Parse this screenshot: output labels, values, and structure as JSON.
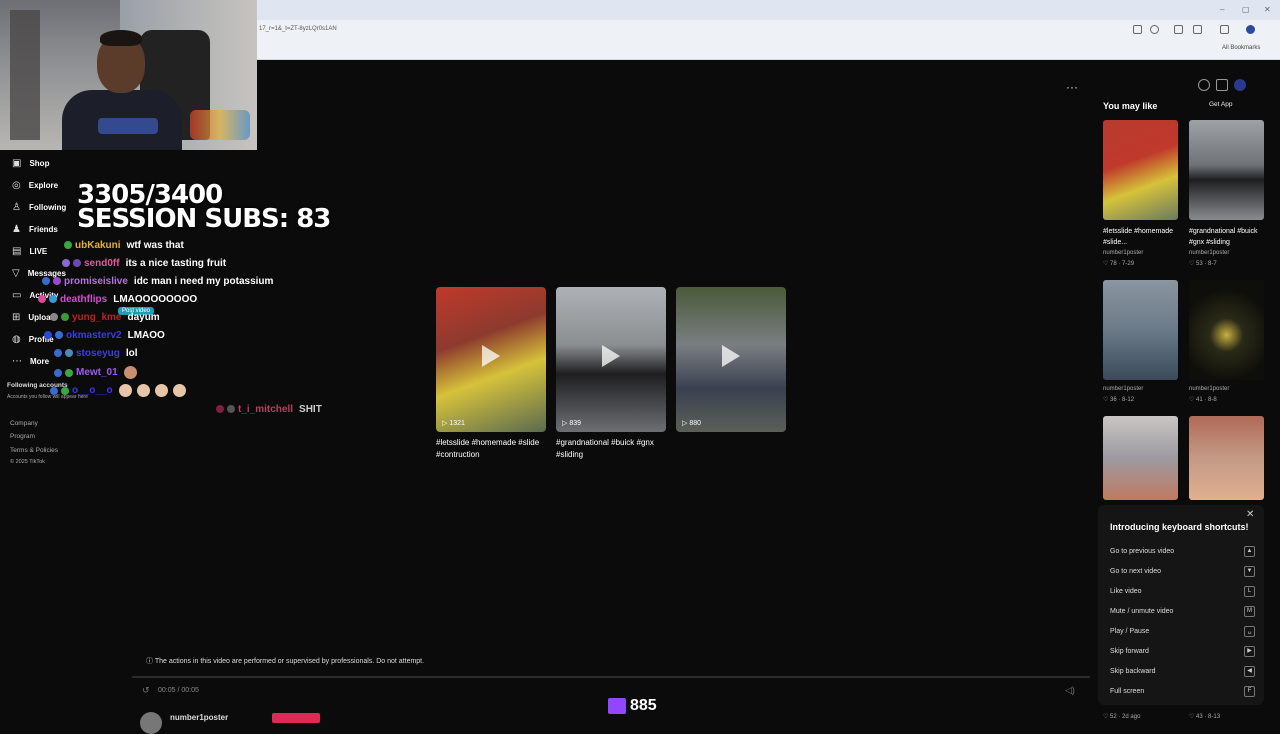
{
  "browser": {
    "url": "17_r=1&_t=ZT-8yzLQr0s1AN",
    "all_bookmarks": "All Bookmarks",
    "min": "–",
    "max": "▢",
    "close": "✕"
  },
  "stream": {
    "sub_counter_line1": "3305/3400",
    "sub_counter_line2": "SESSION SUBS: 83",
    "viewers": "885",
    "chat": [
      {
        "user": "ubKakuni",
        "text": "wtf was that",
        "color": "#e8b02a"
      },
      {
        "user": "send0ff",
        "text": "its a nice tasting fruit",
        "color": "#e05a9d"
      },
      {
        "user": "promiseislive",
        "text": "idc man i need my potassium",
        "color": "#b46ee8"
      },
      {
        "user": "deathflips",
        "text": "LMAOOOOOOOO",
        "color": "#e040e0"
      },
      {
        "user": "yung_kme",
        "text": "dayum",
        "color": "#c02020"
      },
      {
        "user": "okmasterv2",
        "text": "LMAOO",
        "color": "#3a3af0"
      },
      {
        "user": "stoseyug",
        "text": "lol",
        "color": "#3a3af0"
      },
      {
        "user": "Mewt_01",
        "text": "",
        "color": "#9a5af0"
      },
      {
        "user": "o__o__o",
        "text": "",
        "color": "#3a3af0"
      },
      {
        "user": "t_i_mitchell",
        "text": "SHIT",
        "color": "#c03a60"
      }
    ]
  },
  "sidebar": {
    "items": [
      {
        "label": "Shop",
        "icon": "shop-icon"
      },
      {
        "label": "Explore",
        "icon": "compass-icon"
      },
      {
        "label": "Following",
        "icon": "following-icon"
      },
      {
        "label": "Friends",
        "icon": "friends-icon"
      },
      {
        "label": "LIVE",
        "icon": "live-icon"
      },
      {
        "label": "Messages",
        "icon": "messages-icon"
      },
      {
        "label": "Activity",
        "icon": "activity-icon"
      },
      {
        "label": "Upload",
        "icon": "upload-icon"
      },
      {
        "label": "Profile",
        "icon": "profile-icon"
      },
      {
        "label": "More",
        "icon": "more-icon"
      }
    ],
    "post_video": "Post video",
    "following_accounts": "Following accounts",
    "following_hint": "Accounts you follow will appear here",
    "footer": [
      "Company",
      "Program",
      "Terms & Policies",
      "© 2025 TikTok"
    ]
  },
  "main": {
    "more": "···",
    "videos": [
      {
        "views": "1321",
        "caption": "#letsslide #homemade #slide #contruction",
        "color": "#c0392b"
      },
      {
        "views": "839",
        "caption": "#grandnational #buick #gnx #sliding",
        "color": "#6d6f73"
      },
      {
        "views": "880",
        "caption": "",
        "color": "#5b5f58"
      }
    ],
    "notice": "The actions in this video are performed or supervised by professionals. Do not attempt.",
    "time": "00:05 / 00:05",
    "author": "number1poster"
  },
  "right": {
    "get_app": "Get App",
    "title": "You may like",
    "cards": [
      {
        "caption": "#letsslide #homemade #slide...",
        "author": "number1poster",
        "meta": "♡ 78 · 7-29",
        "color": "#b83a2e"
      },
      {
        "caption": "#grandnational #buick #gnx #sliding",
        "author": "number1poster",
        "meta": "♡ 53 · 8-7",
        "color": "#6f7377"
      },
      {
        "caption": "",
        "author": "number1poster",
        "meta": "♡ 36 · 8-12",
        "color": "#6b7a88"
      },
      {
        "caption": "",
        "author": "number1poster",
        "meta": "♡ 41 · 8-8",
        "color": "#1a1a14"
      },
      {
        "caption": "",
        "author": "",
        "meta": "",
        "color": "#9c9aa0"
      },
      {
        "caption": "",
        "author": "",
        "meta": "",
        "color": "#c49a86"
      }
    ],
    "bottom_meta": [
      "♡ 52 · 2d ago",
      "♡ 43 · 8-13"
    ]
  },
  "shortcuts": {
    "title": "Introducing keyboard shortcuts!",
    "close": "✕",
    "items": [
      {
        "label": "Go to previous video",
        "key": "▲"
      },
      {
        "label": "Go to next video",
        "key": "▼"
      },
      {
        "label": "Like video",
        "key": "L"
      },
      {
        "label": "Mute / unmute video",
        "key": "M"
      },
      {
        "label": "Play / Pause",
        "key": "␣"
      },
      {
        "label": "Skip forward",
        "key": "▶"
      },
      {
        "label": "Skip backward",
        "key": "◀"
      },
      {
        "label": "Full screen",
        "key": "F"
      }
    ]
  }
}
